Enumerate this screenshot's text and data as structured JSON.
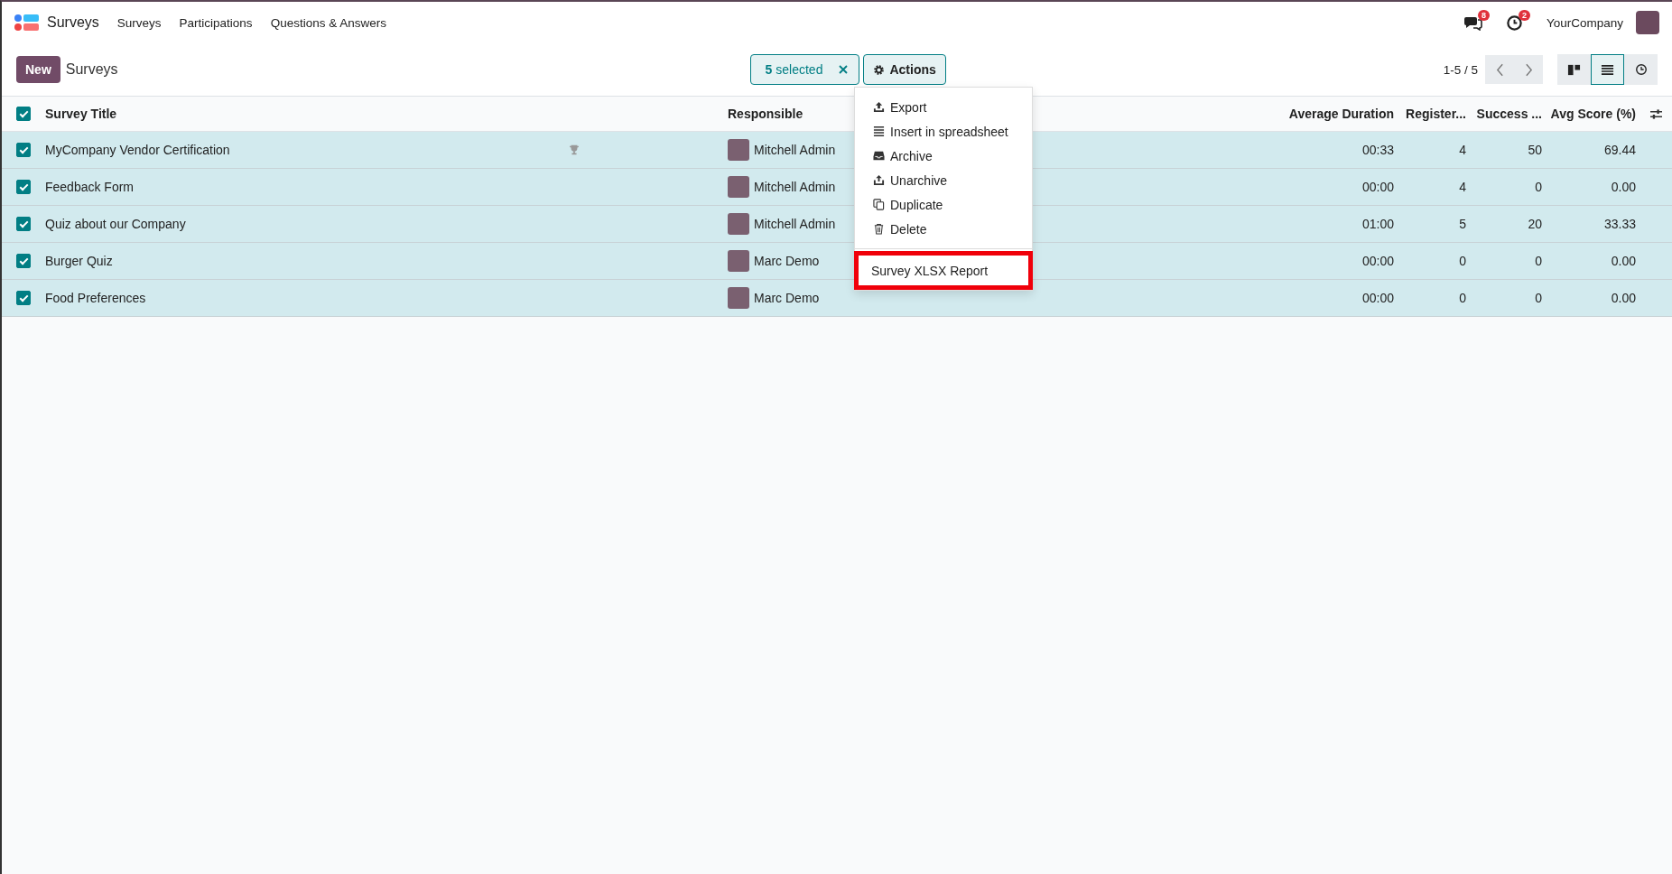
{
  "navbar": {
    "app_name": "Surveys",
    "menu": [
      "Surveys",
      "Participations",
      "Questions & Answers"
    ],
    "messages_badge": "8",
    "activities_badge": "2",
    "company": "YourCompany"
  },
  "control_panel": {
    "new_button": "New",
    "breadcrumb": "Surveys",
    "selection": "**5** selected",
    "actions_button": "Actions",
    "pager": "1-5 / 5",
    "views": [
      {
        "kind": "kanban",
        "selected": false
      },
      {
        "kind": "list",
        "selected": true
      },
      {
        "kind": "activity",
        "selected": false
      }
    ]
  },
  "actions_menu": [
    {
      "label": "Export",
      "kind": "export",
      "highlighted": false
    },
    {
      "label": "Insert in spreadsheet",
      "kind": "spreadsheet",
      "highlighted": false
    },
    {
      "label": "Archive",
      "kind": "archive",
      "highlighted": false
    },
    {
      "label": "Unarchive",
      "kind": "unarchive",
      "highlighted": false
    },
    {
      "label": "Duplicate",
      "kind": "duplicate",
      "highlighted": false
    },
    {
      "label": "Delete",
      "kind": "delete",
      "highlighted": false
    },
    {
      "label": "Survey XLSX Report",
      "kind": "report",
      "highlighted": true
    }
  ],
  "table": {
    "all_selected": true,
    "columns": [
      "Survey Title",
      "Responsible",
      "Average Duration",
      "Register...",
      "Success ...",
      "Avg Score (%)"
    ],
    "rows": [
      {
        "selected": true,
        "title": "MyCompany Vendor Certification",
        "certification": true,
        "responsible": "Mitchell Admin",
        "duration": "00:33",
        "registered": "4",
        "success": "50",
        "score": "69.44"
      },
      {
        "selected": true,
        "title": "Feedback Form",
        "certification": false,
        "responsible": "Mitchell Admin",
        "duration": "00:00",
        "registered": "4",
        "success": "0",
        "score": "0.00"
      },
      {
        "selected": true,
        "title": "Quiz about our Company",
        "certification": false,
        "responsible": "Mitchell Admin",
        "duration": "01:00",
        "registered": "5",
        "success": "20",
        "score": "33.33"
      },
      {
        "selected": true,
        "title": "Burger Quiz",
        "certification": false,
        "responsible": "Marc Demo",
        "duration": "00:00",
        "registered": "0",
        "success": "0",
        "score": "0.00"
      },
      {
        "selected": true,
        "title": "Food Preferences",
        "certification": false,
        "responsible": "Marc Demo",
        "duration": "00:00",
        "registered": "0",
        "success": "0",
        "score": "0.00"
      }
    ]
  }
}
